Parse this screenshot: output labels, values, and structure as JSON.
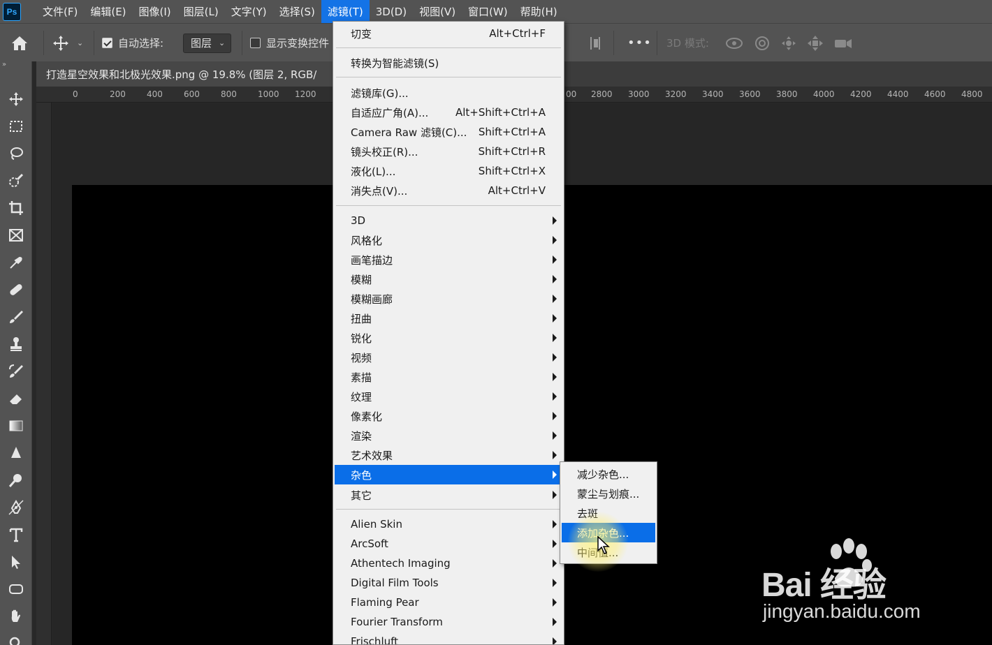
{
  "app": {
    "logo": "Ps"
  },
  "menubar": {
    "items": [
      "文件(F)",
      "编辑(E)",
      "图像(I)",
      "图层(L)",
      "文字(Y)",
      "选择(S)",
      "滤镜(T)",
      "3D(D)",
      "视图(V)",
      "窗口(W)",
      "帮助(H)"
    ],
    "active_index": 6
  },
  "options": {
    "auto_select_label": "自动选择:",
    "auto_select_checked": true,
    "auto_select_value": "图层",
    "show_transform_label": "显示变换控件",
    "show_transform_checked": false,
    "more": "•••",
    "mode_label": "3D 模式:"
  },
  "document": {
    "tab_title": "打造星空效果和北极光效果.png @ 19.8% (图层 2, RGB/",
    "ruler_labels_left": [
      "0",
      "200",
      "400",
      "600",
      "800",
      "1000",
      "1200"
    ],
    "ruler_labels_right": [
      "00",
      "2800",
      "3000",
      "3200",
      "3400",
      "3600",
      "3800",
      "4000",
      "4200",
      "4400",
      "4600",
      "4800"
    ]
  },
  "filter_menu": {
    "last_filter": {
      "label": "切变",
      "shortcut": "Alt+Ctrl+F"
    },
    "convert_smart": "转换为智能滤镜(S)",
    "top_items": [
      {
        "label": "滤镜库(G)...",
        "shortcut": ""
      },
      {
        "label": "自适应广角(A)...",
        "shortcut": "Alt+Shift+Ctrl+A"
      },
      {
        "label": "Camera Raw 滤镜(C)...",
        "shortcut": "Shift+Ctrl+A"
      },
      {
        "label": "镜头校正(R)...",
        "shortcut": "Shift+Ctrl+R"
      },
      {
        "label": "液化(L)...",
        "shortcut": "Shift+Ctrl+X"
      },
      {
        "label": "消失点(V)...",
        "shortcut": "Alt+Ctrl+V"
      }
    ],
    "groups": [
      "3D",
      "风格化",
      "画笔描边",
      "模糊",
      "模糊画廊",
      "扭曲",
      "锐化",
      "视频",
      "素描",
      "纹理",
      "像素化",
      "渲染",
      "艺术效果",
      "杂色",
      "其它"
    ],
    "highlighted_group": "杂色",
    "plugins": [
      "Alien Skin",
      "ArcSoft",
      "Athentech Imaging",
      "Digital Film Tools",
      "Flaming Pear",
      "Fourier Transform",
      "Frischluft"
    ]
  },
  "noise_submenu": {
    "items": [
      "减少杂色...",
      "蒙尘与划痕...",
      "去斑",
      "添加杂色...",
      "中间值..."
    ],
    "highlighted_index": 3
  },
  "watermark": {
    "brand": "Bai 经验",
    "url": "jingyan.baidu.com"
  }
}
